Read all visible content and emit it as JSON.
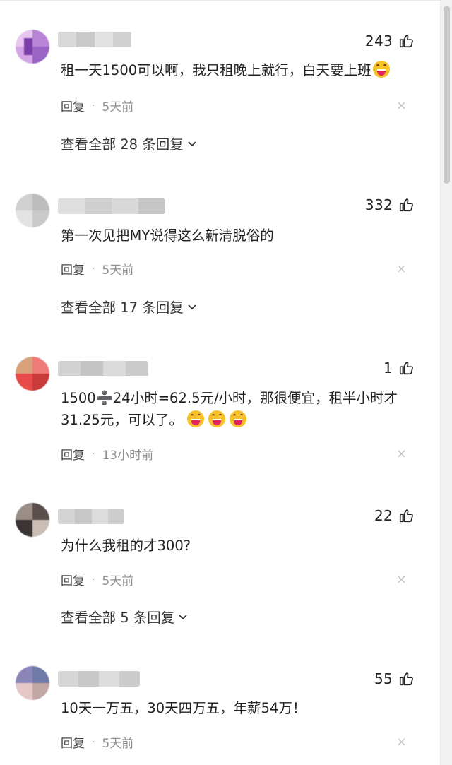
{
  "comments": [
    {
      "likes": "243",
      "text": "租一天1500可以啊，我只租晚上就行，白天要上班",
      "emoji_count": 1,
      "reply_label": "回复",
      "separator": "·",
      "time": "5天前",
      "more_label": "查看全部 28 条回复",
      "avatar_colors": [
        "#e8c6f0",
        "#b784d6",
        "#d5a6e6",
        "#9a66c6"
      ]
    },
    {
      "likes": "332",
      "text": "第一次见把MY说得这么新清脱俗的",
      "emoji_count": 0,
      "reply_label": "回复",
      "separator": "·",
      "time": "5天前",
      "more_label": "查看全部 17 条回复",
      "avatar_colors": [
        "#d0d0d0",
        "#bdbdbd",
        "#e3e3e3",
        "#c9c9c9"
      ]
    },
    {
      "likes": "1",
      "text_line1": "1500➗24小时=62.5元/小时，那很便宜，租半小时才",
      "text_line2": "31.25元，可以了。",
      "emoji_count": 3,
      "reply_label": "回复",
      "separator": "·",
      "time": "13小时前",
      "avatar_colors": [
        "#e84a4a",
        "#d7a279",
        "#f07a7a",
        "#c93a3a"
      ]
    },
    {
      "likes": "22",
      "text": "为什么我租的才300?",
      "emoji_count": 0,
      "reply_label": "回复",
      "separator": "·",
      "time": "5天前",
      "more_label": "查看全部 5 条回复",
      "avatar_colors": [
        "#9a8e86",
        "#5a4f4c",
        "#c9bdb4",
        "#3a3534"
      ]
    },
    {
      "likes": "55",
      "text": "10天一万五，30天四万五，年薪54万！",
      "emoji_count": 0,
      "reply_label": "回复",
      "separator": "·",
      "time": "5天前",
      "avatar_colors": [
        "#8b86b8",
        "#c3a6a6",
        "#6f7aa8",
        "#e6c8c8"
      ]
    }
  ],
  "icons": {
    "like": "thumbs-up-icon",
    "close": "close-icon",
    "expand": "chevron-down-icon"
  },
  "close_glyph": "×"
}
